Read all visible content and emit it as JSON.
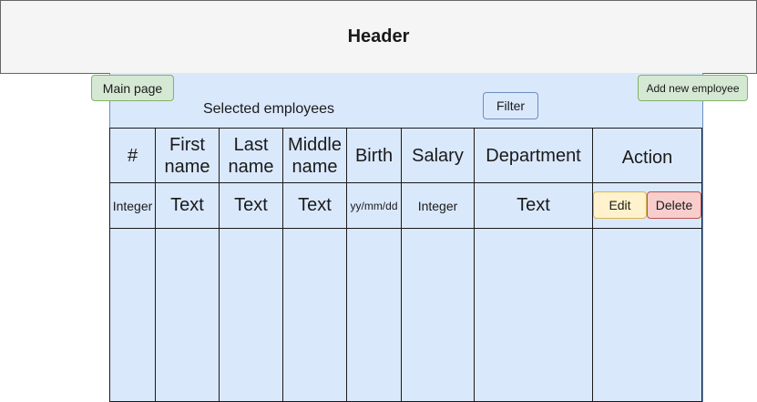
{
  "header": {
    "title": "Header"
  },
  "nav": {
    "main_page": "Main page",
    "add_new_employee": "Add new employee"
  },
  "panel": {
    "selected_label": "Selected employees",
    "filter_label": "Filter"
  },
  "table": {
    "columns": [
      "#",
      "First name",
      "Last name",
      "Middle name",
      "Birth",
      "Salary",
      "Department",
      "Action"
    ],
    "row": [
      "Integer",
      "Text",
      "Text",
      "Text",
      "yy/mm/dd",
      "Integer",
      "Text"
    ],
    "actions": {
      "edit": "Edit",
      "delete": "Delete"
    }
  }
}
